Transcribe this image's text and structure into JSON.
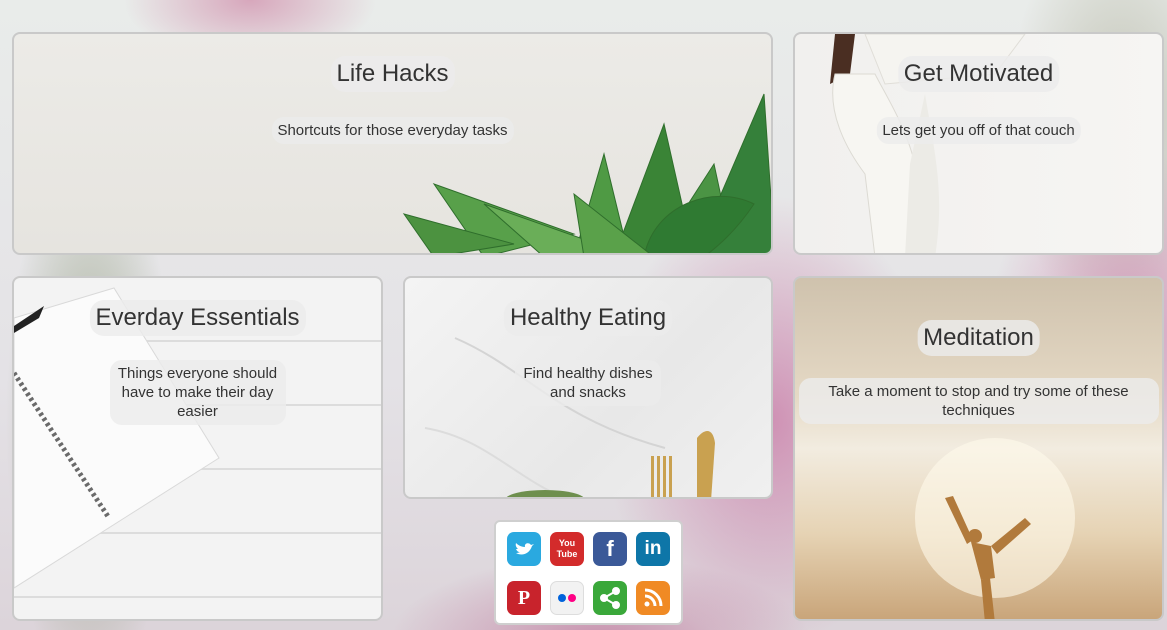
{
  "cards": {
    "life_hacks": {
      "title": "Life Hacks",
      "subtitle": "Shortcuts for those everyday tasks"
    },
    "get_motivated": {
      "title": "Get Motivated",
      "subtitle": "Lets get you off of that couch"
    },
    "everyday_essentials": {
      "title": "Everday Essentials",
      "subtitle": "Things everyone should have to make their day easier"
    },
    "healthy_eating": {
      "title": "Healthy Eating",
      "subtitle": "Find healthy dishes and snacks"
    },
    "meditation": {
      "title": "Meditation",
      "subtitle": "Take a moment to stop and try some of these techniques"
    }
  },
  "social": {
    "twitter": {
      "icon": "twitter-icon",
      "color": "#2aa9e0"
    },
    "youtube": {
      "icon": "youtube-icon",
      "color": "#d32b2b",
      "label": "You Tube"
    },
    "facebook": {
      "icon": "facebook-icon",
      "color": "#3b5998",
      "label": "f"
    },
    "linkedin": {
      "icon": "linkedin-icon",
      "color": "#0e76a8",
      "label": "in"
    },
    "pinterest": {
      "icon": "pinterest-icon",
      "color": "#c8232c",
      "label": "P"
    },
    "flickr": {
      "icon": "flickr-icon",
      "color": "#f2f2f2"
    },
    "share": {
      "icon": "share-icon",
      "color": "#3aa83a"
    },
    "rss": {
      "icon": "rss-icon",
      "color": "#f08a24"
    }
  }
}
